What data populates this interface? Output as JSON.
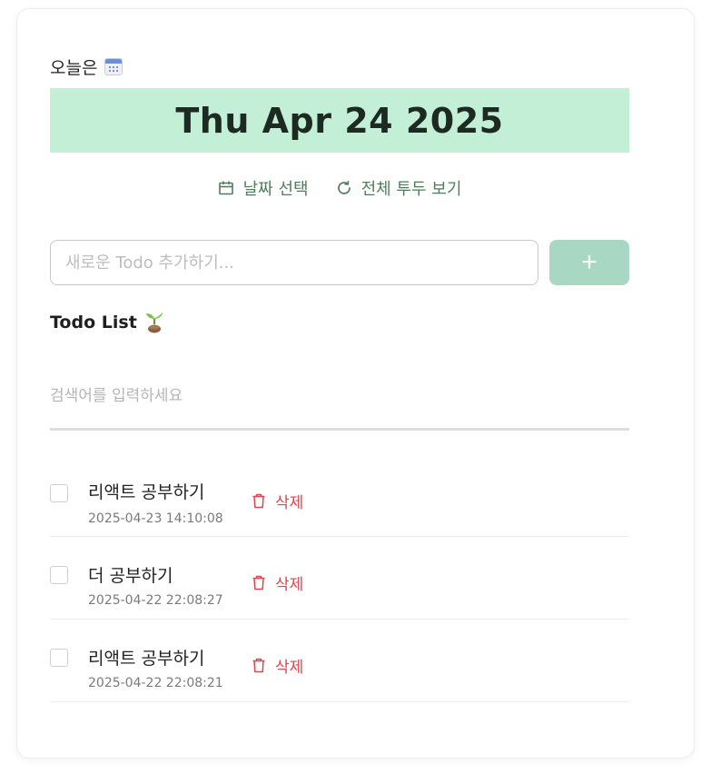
{
  "header": {
    "today_label": "오늘은",
    "date": "Thu Apr 24 2025"
  },
  "actions": {
    "select_date": "날짜 선택",
    "view_all": "전체 투두 보기"
  },
  "add_form": {
    "placeholder": "새로운 Todo 추가하기...",
    "value": "",
    "add_button": "+"
  },
  "list": {
    "title": "Todo List",
    "search_placeholder": "검색어를 입력하세요",
    "search_value": "",
    "delete_label": "삭제",
    "items": [
      {
        "text": "리액트 공부하기",
        "time": "2025-04-23 14:10:08",
        "done": false
      },
      {
        "text": "더 공부하기",
        "time": "2025-04-22 22:08:27",
        "done": false
      },
      {
        "text": "리액트 공부하기",
        "time": "2025-04-22 22:08:21",
        "done": false
      }
    ]
  },
  "colors": {
    "banner_bg": "#c4efd7",
    "accent_green": "#4f7d5c",
    "add_button_bg": "#a8d8c4",
    "delete_red": "#e0454e"
  },
  "icons": {
    "today": "calendar-emoji-icon",
    "select_date": "calendar-icon",
    "view_all": "refresh-icon",
    "list_title": "seedling-icon",
    "delete": "trash-icon"
  }
}
